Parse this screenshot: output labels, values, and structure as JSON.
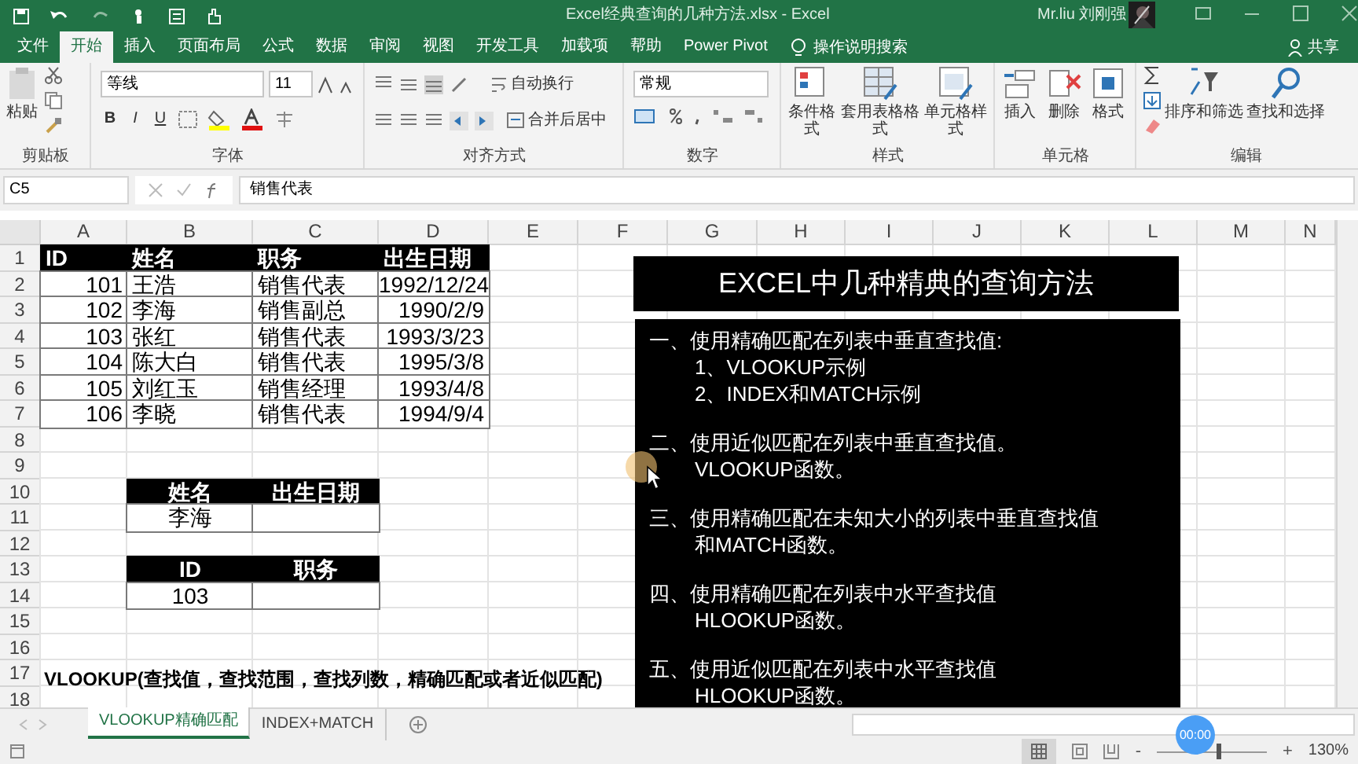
{
  "window": {
    "title": "Excel经典查询的几种方法.xlsx - Excel",
    "user": "Mr.liu 刘刚强"
  },
  "tabs": [
    {
      "label": "文件",
      "selected": false
    },
    {
      "label": "开始",
      "selected": true
    },
    {
      "label": "插入",
      "selected": false
    },
    {
      "label": "页面布局",
      "selected": false
    },
    {
      "label": "公式",
      "selected": false
    },
    {
      "label": "数据",
      "selected": false
    },
    {
      "label": "审阅",
      "selected": false
    },
    {
      "label": "视图",
      "selected": false
    },
    {
      "label": "开发工具",
      "selected": false
    },
    {
      "label": "加载项",
      "selected": false
    },
    {
      "label": "帮助",
      "selected": false
    },
    {
      "label": "Power Pivot",
      "selected": false
    }
  ],
  "tell_me": "操作说明搜索",
  "share": "共享",
  "ribbon": {
    "clipboard": {
      "label": "剪贴板",
      "paste": "粘贴"
    },
    "font": {
      "label": "字体",
      "font_name": "等线",
      "font_size": "11",
      "bold": "B",
      "italic": "I",
      "underline": "U"
    },
    "alignment": {
      "label": "对齐方式",
      "wrap": "自动换行",
      "merge": "合并后居中"
    },
    "number": {
      "label": "数字",
      "format": "常规"
    },
    "styles": {
      "label": "样式",
      "buttons": [
        "条件格式",
        "套用表格格式",
        "单元格样式"
      ]
    },
    "cells": {
      "label": "单元格",
      "buttons": [
        "插入",
        "删除",
        "格式"
      ]
    },
    "editing": {
      "label": "编辑",
      "buttons": [
        "排序和筛选",
        "查找和选择"
      ]
    }
  },
  "formula_bar": {
    "name_box": "C5",
    "formula": "销售代表"
  },
  "sheet": {
    "columns": [
      "A",
      "B",
      "C",
      "D",
      "E",
      "F",
      "G",
      "H",
      "I",
      "J",
      "K",
      "L",
      "M",
      "N"
    ],
    "rows": [
      {
        "label": "1",
        "cells": [
          {
            "text": "ID",
            "kind": "header"
          },
          {
            "text": "姓名",
            "kind": "header"
          },
          {
            "text": "职务",
            "kind": "header"
          },
          {
            "text": "出生日期",
            "kind": "header"
          }
        ]
      },
      {
        "label": "2",
        "cells": [
          {
            "text": "101",
            "kind": "number"
          },
          {
            "text": "王浩",
            "kind": "text"
          },
          {
            "text": "销售代表",
            "kind": "text"
          },
          {
            "text": "1992/12/24",
            "kind": "number"
          }
        ]
      },
      {
        "label": "3",
        "cells": [
          {
            "text": "102",
            "kind": "number"
          },
          {
            "text": "李海",
            "kind": "text"
          },
          {
            "text": "销售副总",
            "kind": "text"
          },
          {
            "text": "1990/2/9",
            "kind": "number"
          }
        ]
      },
      {
        "label": "4",
        "cells": [
          {
            "text": "103",
            "kind": "number"
          },
          {
            "text": "张红",
            "kind": "text"
          },
          {
            "text": "销售代表",
            "kind": "text"
          },
          {
            "text": "1993/3/23",
            "kind": "number"
          }
        ]
      },
      {
        "label": "5",
        "cells": [
          {
            "text": "104",
            "kind": "number"
          },
          {
            "text": "陈大白",
            "kind": "text"
          },
          {
            "text": "销售代表",
            "kind": "text"
          },
          {
            "text": "1995/3/8",
            "kind": "number"
          }
        ]
      },
      {
        "label": "6",
        "cells": [
          {
            "text": "105",
            "kind": "number"
          },
          {
            "text": "刘红玉",
            "kind": "text"
          },
          {
            "text": "销售经理",
            "kind": "text"
          },
          {
            "text": "1993/4/8",
            "kind": "number"
          }
        ]
      },
      {
        "label": "7",
        "cells": [
          {
            "text": "106",
            "kind": "number"
          },
          {
            "text": "李晓",
            "kind": "text"
          },
          {
            "text": "销售代表",
            "kind": "text"
          },
          {
            "text": "1994/9/4",
            "kind": "number"
          }
        ]
      },
      {
        "label": "8"
      },
      {
        "label": "9"
      },
      {
        "label": "10",
        "cells": [
          {
            "kind": "empty"
          },
          {
            "text": "姓名",
            "kind": "header-centered"
          },
          {
            "text": "出生日期",
            "kind": "header-centered"
          }
        ]
      },
      {
        "label": "11",
        "cells": [
          {
            "kind": "empty"
          },
          {
            "text": "李海",
            "kind": "centered"
          },
          {
            "kind": "blank"
          }
        ]
      },
      {
        "label": "12"
      },
      {
        "label": "13",
        "cells": [
          {
            "kind": "empty"
          },
          {
            "text": "ID",
            "kind": "header-centered"
          },
          {
            "text": "职务",
            "kind": "header-centered"
          }
        ]
      },
      {
        "label": "14",
        "cells": [
          {
            "kind": "empty"
          },
          {
            "text": "103",
            "kind": "centered"
          },
          {
            "kind": "blank"
          }
        ]
      },
      {
        "label": "15"
      },
      {
        "label": "16"
      },
      {
        "label": "17",
        "cells": [
          {
            "text": "VLOOKUP(查找值，查找范围，查找列数，精确匹配或者近似匹配)",
            "kind": "note"
          }
        ]
      },
      {
        "label": "18"
      }
    ]
  },
  "text_box": {
    "title": "EXCEL中几种精典的查询方法",
    "items": [
      {
        "text": "一、使用精确匹配在列表中垂直查找值:",
        "children": [
          {
            "text": "1、VLOOKUP示例"
          },
          {
            "text": "2、INDEX和MATCH示例"
          }
        ]
      },
      {
        "text": "二、使用近似匹配在列表中垂直查找值。",
        "children": [
          {
            "text": "VLOOKUP函数。"
          }
        ]
      },
      {
        "text": "三、使用精确匹配在未知大小的列表中垂直查找值",
        "children": [
          {
            "text": "和MATCH函数。"
          }
        ]
      },
      {
        "text": "四、使用精确匹配在列表中水平查找值",
        "children": [
          {
            "text": "HLOOKUP函数。"
          }
        ]
      },
      {
        "text": "五、使用近似匹配在列表中水平查找值",
        "children": [
          {
            "text": "HLOOKUP函数。"
          }
        ]
      }
    ]
  },
  "sheet_tabs": [
    {
      "label": "VLOOKUP精确匹配",
      "selected": true
    },
    {
      "label": "INDEX+MATCH",
      "selected": false
    }
  ],
  "status_bar": {
    "zoom": {
      "level": 0.57,
      "reading": "130%",
      "zoom_out": "-",
      "zoom_in": "+"
    }
  },
  "video_overlay": {
    "timer": "00:00"
  }
}
